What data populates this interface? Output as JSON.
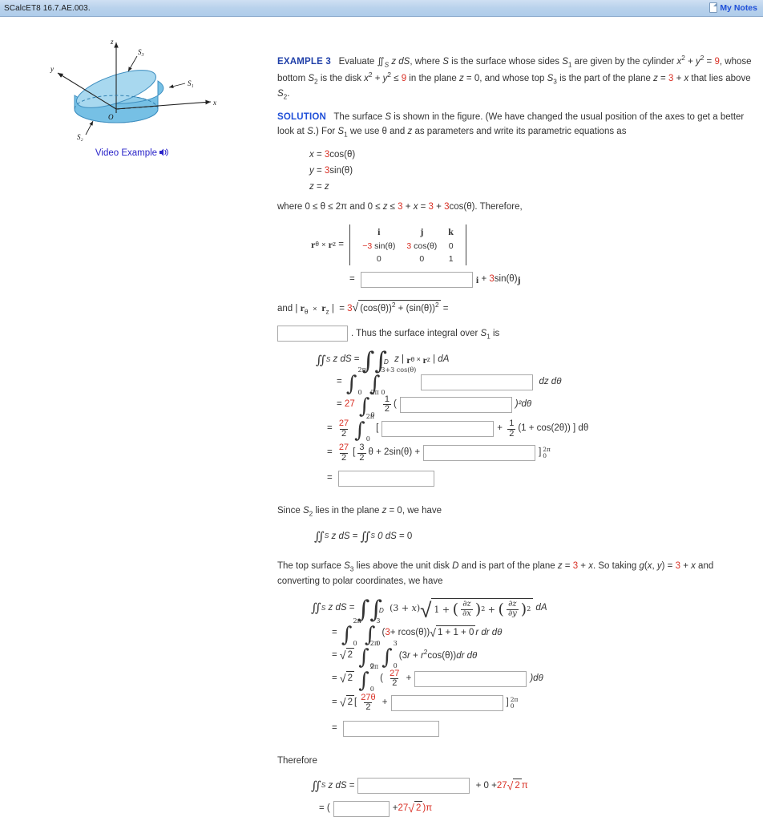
{
  "header": {
    "assignment_id": "SCalcET8 16.7.AE.003.",
    "my_notes_label": "My Notes",
    "note_icon": "note-page-icon"
  },
  "figure": {
    "axis_x": "x",
    "axis_y": "y",
    "axis_z": "z",
    "origin": "O",
    "label_s1": "S₁",
    "label_s2": "S₂",
    "label_s3": "S₃",
    "video_example_label": "Video Example",
    "speaker_icon": "speaker-icon",
    "surface_fill": "#7fc4e8",
    "surface_fill_light": "#a8d8ef",
    "surface_stroke": "#3f8fc0"
  },
  "problem": {
    "example_label": "EXAMPLE 3",
    "text_1": "Evaluate ∬",
    "text_s_sub": "S",
    "text_2": " z dS, where S is the surface whose sides S",
    "text_3": " are given by the cylinder x",
    "text_4": " + y",
    "eq_nine": "9",
    "text_5": ", whose bottom S",
    "text_6": " is the disk x",
    "text_7": " + y",
    "text_8": " ≤ ",
    "nine_2": "9",
    "text_9": " in the plane z = 0, and whose top S",
    "text_10": " is the part of the plane z = ",
    "three_plane": "3",
    "text_11": " + x that lies above S",
    "text_12": "."
  },
  "solution": {
    "label": "SOLUTION",
    "intro": "The surface S is shown in the figure. (We have changed the usual position of the axes to get a better look at S.) For S",
    "intro_2": " we use θ and z as parameters and write its parametric equations as",
    "param_x_lhs": "x = ",
    "param_x_coef": "3",
    "param_x_rhs": "cos(θ)",
    "param_y_lhs": "y = ",
    "param_y_coef": "3",
    "param_y_rhs": "sin(θ)",
    "param_z": "z = z",
    "where_1": "where 0 ≤ θ ≤ 2π and 0 ≤ z ≤ ",
    "where_three": "3",
    "where_2": " + x = ",
    "where_three2": "3",
    "where_3": " + ",
    "where_three3": "3",
    "where_4": "cos(θ). Therefore,"
  },
  "cross_product": {
    "lhs": "r",
    "lhs_sub_theta": "θ",
    "lhs_x": "×",
    "lhs_r": "r",
    "lhs_sub_z": "z",
    "eq": "=",
    "head_i": "i",
    "head_j": "j",
    "head_k": "k",
    "row1_c1_red": "−3",
    "row1_c1_rest": " sin(θ)",
    "row1_c2_red": "3",
    "row1_c2_rest": " cos(θ)",
    "row1_c3": "0",
    "row2_c1": "0",
    "row2_c2": "0",
    "row2_c3": "1",
    "result_prefix": "=",
    "answer_box_1": "",
    "result_suffix_i": "i + ",
    "result_coef": "3",
    "result_sin": "sin(θ)",
    "result_j": "j"
  },
  "magnitude": {
    "lead": "and | ",
    "r_theta": "r",
    "sub_theta": "θ",
    "times": "×",
    "r_z": "r",
    "sub_z": "z",
    "bar_eq": " | = ",
    "coef": "3",
    "radicand": "(cos(θ))² + (sin(θ))²",
    "equals": "=",
    "answer_box_2": "",
    "after": ". Thus the surface integral over S",
    "after_sub": "1",
    "after_2": " is"
  },
  "integral_s1": {
    "line1_lhs": "∬",
    "line1_sub": "S",
    "line1_mid": " z dS = ",
    "line1_int": "∬",
    "line1_intsub": "D",
    "line1_rhs": "z | r",
    "line1_rhs_sub1": "θ",
    "line1_rhs_x": "×",
    "line1_rhs_r": "r",
    "line1_rhs_sub2": "z",
    "line1_rhs_end": " | dA",
    "line2_eq": "=",
    "line2_upper1": "2π",
    "line2_lower1": "0",
    "line2_upper2": "3+3 cos(θ)",
    "line2_lower2": "0",
    "answer_box_3": "",
    "line2_tail": "dz dθ",
    "line3_eq": "=",
    "line3_coef": "27",
    "line3_upper": "2π",
    "line3_lower": "0",
    "line3_frac_num": "1",
    "line3_frac_den": "2",
    "line3_paren": "(",
    "answer_box_4": "",
    "line3_tail": ")²dθ",
    "line4_eq": "=",
    "line4_frac_num": "27",
    "line4_frac_den": "2",
    "line4_upper": "2π",
    "line4_lower": "0",
    "line4_bracket": "[",
    "answer_box_5": "",
    "line4_plus": "+",
    "line4_frac2_num": "1",
    "line4_frac2_den": "2",
    "line4_tail": "(1 + cos(2θ)) ] dθ",
    "line5_eq": "=",
    "line5_frac_num": "27",
    "line5_frac_den": "2",
    "line5_bracket": "[",
    "line5_frac2_num": "3",
    "line5_frac2_den": "2",
    "line5_mid": "θ + 2sin(θ) +",
    "answer_box_6": "",
    "line5_close": "]",
    "line5_eval_up": "2π",
    "line5_eval_lo": "0",
    "line6_eq": "=",
    "answer_box_7": ""
  },
  "s2_section": {
    "text": "Since S",
    "text_sub": "2",
    "text_2": " lies in the plane z = 0, we have",
    "eq_lhs": "∬",
    "eq_sub": "S",
    "eq_mid": " z dS = ∬",
    "eq_sub2": "S",
    "eq_rhs": " 0 dS = 0"
  },
  "s3_section": {
    "text_1": "The top surface S",
    "text_sub": "3",
    "text_2": " lies above the unit disk D and is part of the plane z = ",
    "three_a": "3",
    "text_3": " + x. So taking g(x, y) = ",
    "three_b": "3",
    "text_4": " + x and converting to polar coordinates, we have",
    "l1_lhs": "∬",
    "l1_sub": "S",
    "l1_mid": " z dS = ",
    "l1_int": "∬",
    "l1_intsub": "D",
    "l1_expr": "(3 + x)",
    "l1_rad_one": "1 +",
    "l1_dz": "∂z",
    "l1_dx": "∂x",
    "l1_dy": "∂y",
    "l1_pow": "2",
    "l1_plus": "+",
    "l1_tail": "dA",
    "l2_eq": "=",
    "l2_upper1": "2π",
    "l2_lower1": "0",
    "l2_upper2": "3",
    "l2_lower2": "0",
    "l2_three": "3",
    "l2_expr": " + rcos(θ))",
    "l2_open": "(",
    "l2_rad": "1 + 1 + 0",
    "l2_tail": "r dr dθ",
    "l3_eq": "=",
    "l3_sqrt": "2",
    "l3_upper1": "2π",
    "l3_lower1": "0",
    "l3_upper2": "3",
    "l3_lower2": "0",
    "l3_expr": "(3r + r²cos(θ))dr dθ",
    "l4_eq": "=",
    "l4_sqrt": "2",
    "l4_upper": "2π",
    "l4_lower": "0",
    "l4_open": "(",
    "l4_frac_num": "27",
    "l4_frac_den": "2",
    "l4_plus": "+",
    "answer_box_8": "",
    "l4_close": ")dθ",
    "l5_eq": "=",
    "l5_sqrt": "2",
    "l5_bracket": "[",
    "l5_frac_num": "27θ",
    "l5_frac_den": "2",
    "l5_plus": "+",
    "answer_box_9": "",
    "l5_close": "]",
    "l5_eval_up": "2π",
    "l5_eval_lo": "0",
    "l6_eq": "=",
    "answer_box_10": ""
  },
  "therefore": {
    "label": "Therefore",
    "line1_lhs": "∬",
    "line1_sub": "S",
    "line1_mid": " z dS =",
    "answer_box_11": "",
    "line1_tail_plain": "+ 0 + ",
    "line1_tail_red": "27",
    "line1_sqrt": "2",
    "line1_pi": "π",
    "line2_eq": "= (",
    "answer_box_12": "",
    "line2_plus": "+ ",
    "line2_red": "27",
    "line2_sqrt": "2",
    "line2_tail": ")π"
  },
  "colors": {
    "header_bg": "#b9d2ec",
    "link_blue": "#1f4fd8",
    "accent_red": "#d93025",
    "text": "#333333",
    "box_border": "#a9a9a9"
  }
}
